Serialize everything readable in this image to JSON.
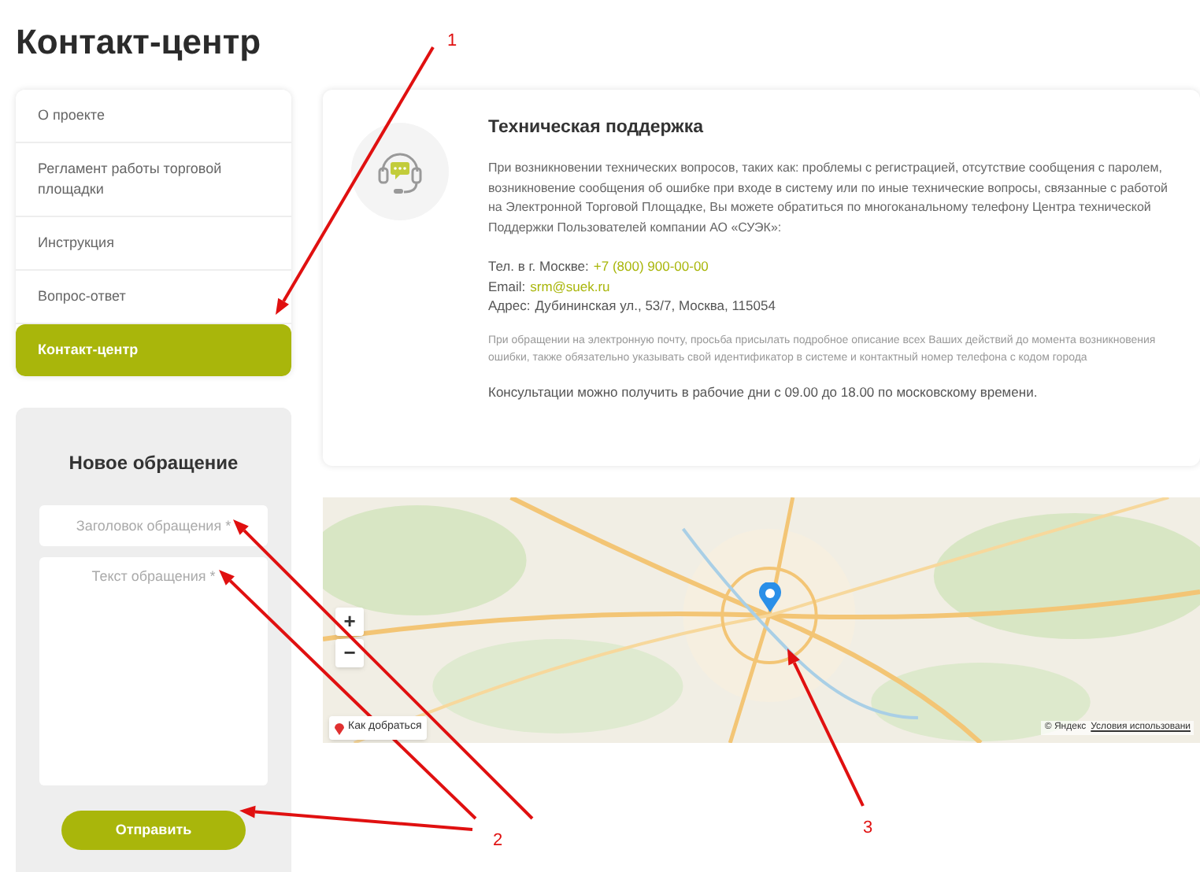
{
  "page": {
    "title": "Контакт-центр"
  },
  "sidebar": {
    "items": [
      {
        "label": "О проекте",
        "selected": false
      },
      {
        "label": "Регламент работы торговой площадки",
        "selected": false
      },
      {
        "label": "Инструкция",
        "selected": false
      },
      {
        "label": "Вопрос-ответ",
        "selected": false
      },
      {
        "label": "Контакт-центр",
        "selected": true
      }
    ]
  },
  "form": {
    "title": "Новое обращение",
    "fields": [
      {
        "kind": "input",
        "placeholder": "Заголовок обращения *"
      },
      {
        "kind": "textarea",
        "placeholder": "Текст обращения *"
      }
    ],
    "submit": "Отправить"
  },
  "support": {
    "title": "Техническая поддержка",
    "description": "При возникновении технических вопросов, таких как: проблемы с регистрацией, отсутствие сообщения с паролем, возникновение сообщения об ошибке при входе в систему или по иные технические вопросы, связанные с работой на Электронной Торговой Площадке, Вы можете обратиться по многоканальному телефону Центра технической Поддержки Пользователей компании АО «СУЭК»:",
    "contacts": [
      {
        "kind": "link",
        "label": "Тел. в г. Москве:",
        "value": "+7 (800) 900-00-00"
      },
      {
        "kind": "link",
        "label": "Email:",
        "value": "srm@suek.ru"
      },
      {
        "kind": "text",
        "label": "Адрес:",
        "value": "Дубининская ул., 53/7, Москва, 115054"
      }
    ],
    "note": "При обращении на электронную почту, просьба присылать подробное описание всех Ваших действий до момента возникновения ошибки, также обязательно указывать свой идентификатор в системе и контактный номер телефона с кодом города",
    "hours": "Консультации можно получить в рабочие дни с 09.00 до 18.00 по московскому времени."
  },
  "map": {
    "zoom_in": "+",
    "zoom_out": "−",
    "route_button": "Как добраться",
    "copyright": "© Яндекс",
    "terms_link": "Условия использовани"
  },
  "annotations": [
    {
      "label": "1"
    },
    {
      "label": "2"
    },
    {
      "label": "3"
    }
  ]
}
